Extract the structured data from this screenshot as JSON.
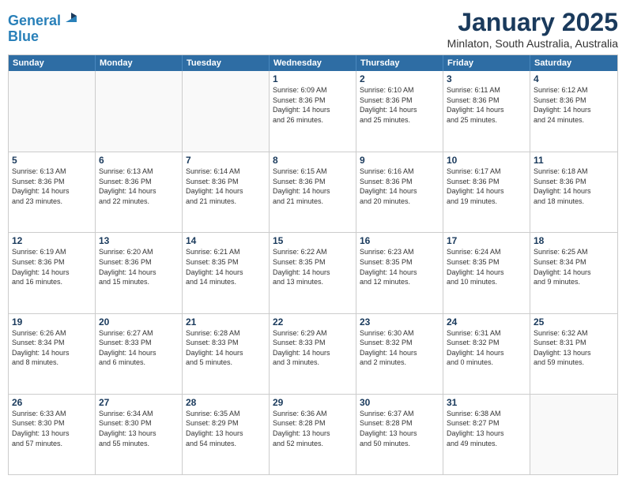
{
  "logo": {
    "line1": "General",
    "line2": "Blue"
  },
  "header": {
    "month": "January 2025",
    "location": "Minlaton, South Australia, Australia"
  },
  "day_headers": [
    "Sunday",
    "Monday",
    "Tuesday",
    "Wednesday",
    "Thursday",
    "Friday",
    "Saturday"
  ],
  "weeks": [
    [
      {
        "day": "",
        "info": ""
      },
      {
        "day": "",
        "info": ""
      },
      {
        "day": "",
        "info": ""
      },
      {
        "day": "1",
        "info": "Sunrise: 6:09 AM\nSunset: 8:36 PM\nDaylight: 14 hours\nand 26 minutes."
      },
      {
        "day": "2",
        "info": "Sunrise: 6:10 AM\nSunset: 8:36 PM\nDaylight: 14 hours\nand 25 minutes."
      },
      {
        "day": "3",
        "info": "Sunrise: 6:11 AM\nSunset: 8:36 PM\nDaylight: 14 hours\nand 25 minutes."
      },
      {
        "day": "4",
        "info": "Sunrise: 6:12 AM\nSunset: 8:36 PM\nDaylight: 14 hours\nand 24 minutes."
      }
    ],
    [
      {
        "day": "5",
        "info": "Sunrise: 6:13 AM\nSunset: 8:36 PM\nDaylight: 14 hours\nand 23 minutes."
      },
      {
        "day": "6",
        "info": "Sunrise: 6:13 AM\nSunset: 8:36 PM\nDaylight: 14 hours\nand 22 minutes."
      },
      {
        "day": "7",
        "info": "Sunrise: 6:14 AM\nSunset: 8:36 PM\nDaylight: 14 hours\nand 21 minutes."
      },
      {
        "day": "8",
        "info": "Sunrise: 6:15 AM\nSunset: 8:36 PM\nDaylight: 14 hours\nand 21 minutes."
      },
      {
        "day": "9",
        "info": "Sunrise: 6:16 AM\nSunset: 8:36 PM\nDaylight: 14 hours\nand 20 minutes."
      },
      {
        "day": "10",
        "info": "Sunrise: 6:17 AM\nSunset: 8:36 PM\nDaylight: 14 hours\nand 19 minutes."
      },
      {
        "day": "11",
        "info": "Sunrise: 6:18 AM\nSunset: 8:36 PM\nDaylight: 14 hours\nand 18 minutes."
      }
    ],
    [
      {
        "day": "12",
        "info": "Sunrise: 6:19 AM\nSunset: 8:36 PM\nDaylight: 14 hours\nand 16 minutes."
      },
      {
        "day": "13",
        "info": "Sunrise: 6:20 AM\nSunset: 8:36 PM\nDaylight: 14 hours\nand 15 minutes."
      },
      {
        "day": "14",
        "info": "Sunrise: 6:21 AM\nSunset: 8:35 PM\nDaylight: 14 hours\nand 14 minutes."
      },
      {
        "day": "15",
        "info": "Sunrise: 6:22 AM\nSunset: 8:35 PM\nDaylight: 14 hours\nand 13 minutes."
      },
      {
        "day": "16",
        "info": "Sunrise: 6:23 AM\nSunset: 8:35 PM\nDaylight: 14 hours\nand 12 minutes."
      },
      {
        "day": "17",
        "info": "Sunrise: 6:24 AM\nSunset: 8:35 PM\nDaylight: 14 hours\nand 10 minutes."
      },
      {
        "day": "18",
        "info": "Sunrise: 6:25 AM\nSunset: 8:34 PM\nDaylight: 14 hours\nand 9 minutes."
      }
    ],
    [
      {
        "day": "19",
        "info": "Sunrise: 6:26 AM\nSunset: 8:34 PM\nDaylight: 14 hours\nand 8 minutes."
      },
      {
        "day": "20",
        "info": "Sunrise: 6:27 AM\nSunset: 8:33 PM\nDaylight: 14 hours\nand 6 minutes."
      },
      {
        "day": "21",
        "info": "Sunrise: 6:28 AM\nSunset: 8:33 PM\nDaylight: 14 hours\nand 5 minutes."
      },
      {
        "day": "22",
        "info": "Sunrise: 6:29 AM\nSunset: 8:33 PM\nDaylight: 14 hours\nand 3 minutes."
      },
      {
        "day": "23",
        "info": "Sunrise: 6:30 AM\nSunset: 8:32 PM\nDaylight: 14 hours\nand 2 minutes."
      },
      {
        "day": "24",
        "info": "Sunrise: 6:31 AM\nSunset: 8:32 PM\nDaylight: 14 hours\nand 0 minutes."
      },
      {
        "day": "25",
        "info": "Sunrise: 6:32 AM\nSunset: 8:31 PM\nDaylight: 13 hours\nand 59 minutes."
      }
    ],
    [
      {
        "day": "26",
        "info": "Sunrise: 6:33 AM\nSunset: 8:30 PM\nDaylight: 13 hours\nand 57 minutes."
      },
      {
        "day": "27",
        "info": "Sunrise: 6:34 AM\nSunset: 8:30 PM\nDaylight: 13 hours\nand 55 minutes."
      },
      {
        "day": "28",
        "info": "Sunrise: 6:35 AM\nSunset: 8:29 PM\nDaylight: 13 hours\nand 54 minutes."
      },
      {
        "day": "29",
        "info": "Sunrise: 6:36 AM\nSunset: 8:28 PM\nDaylight: 13 hours\nand 52 minutes."
      },
      {
        "day": "30",
        "info": "Sunrise: 6:37 AM\nSunset: 8:28 PM\nDaylight: 13 hours\nand 50 minutes."
      },
      {
        "day": "31",
        "info": "Sunrise: 6:38 AM\nSunset: 8:27 PM\nDaylight: 13 hours\nand 49 minutes."
      },
      {
        "day": "",
        "info": ""
      }
    ]
  ]
}
